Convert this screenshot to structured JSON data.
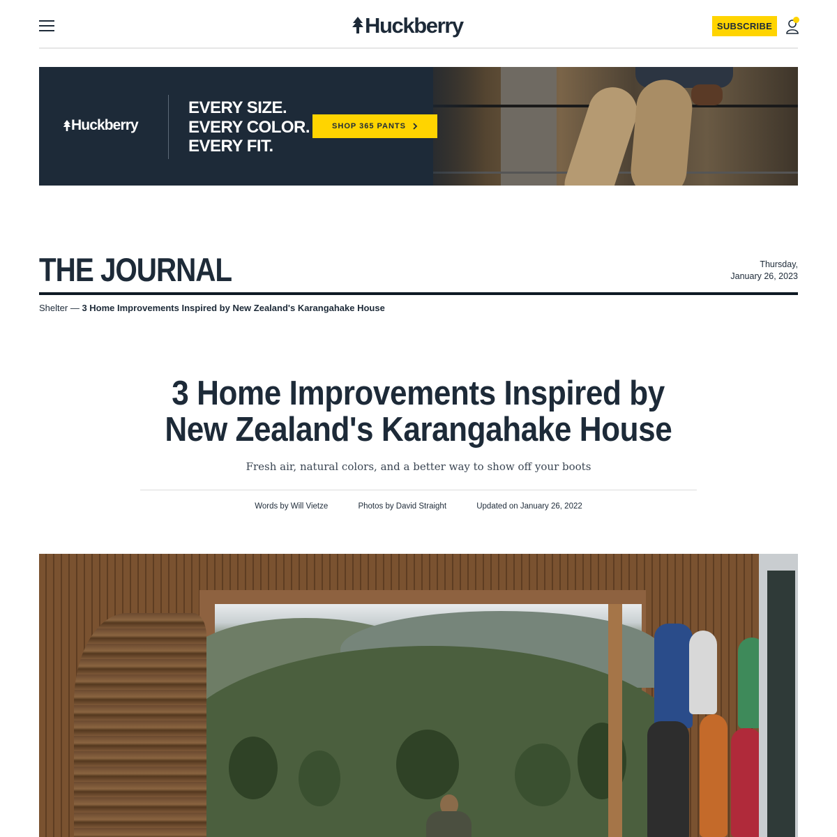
{
  "header": {
    "brand": "Huckberry",
    "subscribe_label": "SUBSCRIBE"
  },
  "banner": {
    "brand": "Huckberry",
    "tagline": [
      "EVERY SIZE.",
      "EVERY COLOR.",
      "EVERY FIT."
    ],
    "cta_label": "SHOP 365 PANTS"
  },
  "journal": {
    "title": "THE JOURNAL",
    "date_line1": "Thursday,",
    "date_line2": "January 26, 2023"
  },
  "breadcrumb": {
    "section": "Shelter",
    "separator": " — ",
    "current": "3 Home Improvements Inspired by New Zealand's Karangahake House"
  },
  "article": {
    "title_line1": "3 Home Improvements Inspired by",
    "title_line2": "New Zealand's Karangahake House",
    "dek": "Fresh air, natural colors, and a better way to show off your boots",
    "byline": {
      "words": "Words by  Will Vietze",
      "photos": "Photos by  David Straight",
      "updated": "Updated on  January 26, 2022"
    }
  },
  "colors": {
    "navy": "#1d2a38",
    "accent_yellow": "#ffd400"
  },
  "icons": [
    "menu-icon",
    "tree-logo-icon",
    "user-icon",
    "chevron-right-icon"
  ]
}
